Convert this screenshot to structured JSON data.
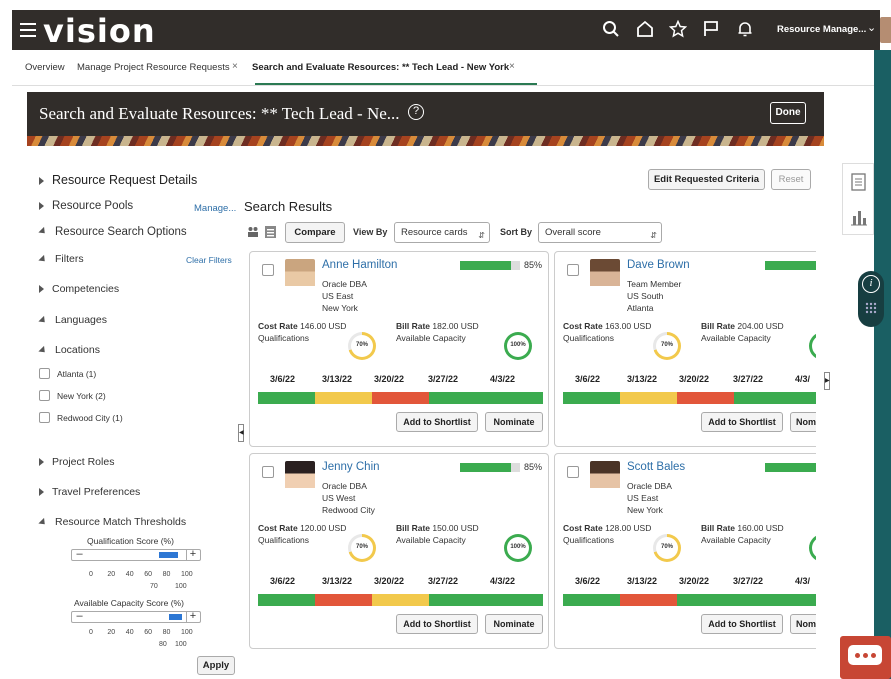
{
  "app": {
    "logo": "vision",
    "user_label": "Resource Manage..."
  },
  "tabs": [
    {
      "label": "Overview",
      "closable": false
    },
    {
      "label": "Manage Project Resource Requests",
      "closable": true
    },
    {
      "label": "Search and Evaluate Resources: ** Tech Lead - New York",
      "closable": true,
      "active": true
    }
  ],
  "hero": {
    "title": "Search and Evaluate Resources: ** Tech Lead - Ne...",
    "done_label": "Done",
    "help": "?"
  },
  "left": {
    "resource_request_details": "Resource Request Details",
    "resource_pools": "Resource Pools",
    "manage_link": "Manage...",
    "resource_search_options": "Resource Search Options",
    "filters": "Filters",
    "clear_filters": "Clear Filters",
    "competencies": "Competencies",
    "languages": "Languages",
    "locations": "Locations",
    "location_options": [
      "Atlanta (1)",
      "New York (2)",
      "Redwood City (1)"
    ],
    "project_roles": "Project Roles",
    "travel_preferences": "Travel Preferences",
    "thresholds": "Resource Match Thresholds",
    "qual_slider": {
      "label": "Qualification Score (%)",
      "ticks": [
        "0",
        "20",
        "40",
        "60",
        "80",
        "100"
      ],
      "value_labels": [
        "70",
        "100"
      ],
      "range": [
        70,
        100
      ]
    },
    "avail_slider": {
      "label": "Available Capacity Score (%)",
      "ticks": [
        "0",
        "20",
        "40",
        "60",
        "80",
        "100"
      ],
      "value_labels": [
        "80",
        "100"
      ],
      "range": [
        80,
        100
      ]
    },
    "apply": "Apply"
  },
  "results": {
    "title": "Search Results",
    "edit_criteria": "Edit Requested Criteria",
    "reset": "Reset",
    "compare": "Compare",
    "view_by_label": "View By",
    "view_by_value": "Resource cards",
    "sort_by_label": "Sort By",
    "sort_by_value": "Overall score",
    "add_to_shortlist": "Add to Shortlist",
    "nominate": "Nominate",
    "nominate_cut": "Nom",
    "cost_rate_label": "Cost Rate",
    "bill_rate_label": "Bill Rate",
    "qualifications_label": "Qualifications",
    "available_capacity_label": "Available Capacity",
    "dates": [
      "3/6/22",
      "3/13/22",
      "3/20/22",
      "3/27/22",
      "4/3/22"
    ],
    "dates_cut": "4/3/",
    "cards": [
      {
        "name": "Anne Hamilton",
        "title": "Oracle DBA",
        "region": "US East",
        "city": "New York",
        "score": "85%",
        "score_value": 85,
        "cost": "146.00 USD",
        "bill": "182.00 USD",
        "qual": "70%",
        "qual_value": 70,
        "cap": "100%",
        "cap_value": 100,
        "avail": [
          "green",
          "yellow",
          "red",
          "green",
          "green"
        ]
      },
      {
        "name": "Dave Brown",
        "title": "Team Member",
        "region": "US South",
        "city": "Atlanta",
        "score": "",
        "score_value": 85,
        "cost": "163.00 USD",
        "bill": "204.00 USD",
        "qual": "70%",
        "qual_value": 70,
        "cap": "",
        "cap_value": 100,
        "avail": [
          "green",
          "yellow",
          "red",
          "green",
          "green"
        ]
      },
      {
        "name": "Jenny Chin",
        "title": "Oracle DBA",
        "region": "US West",
        "city": "Redwood City",
        "score": "85%",
        "score_value": 85,
        "cost": "120.00 USD",
        "bill": "150.00 USD",
        "qual": "70%",
        "qual_value": 70,
        "cap": "100%",
        "cap_value": 100,
        "avail": [
          "green",
          "red",
          "yellow",
          "green",
          "green"
        ]
      },
      {
        "name": "Scott Bales",
        "title": "Oracle DBA",
        "region": "US East",
        "city": "New York",
        "score": "",
        "score_value": 85,
        "cost": "128.00 USD",
        "bill": "160.00 USD",
        "qual": "70%",
        "qual_value": 70,
        "cap": "",
        "cap_value": 100,
        "avail": [
          "green",
          "red",
          "green",
          "green",
          "green"
        ]
      }
    ]
  },
  "colors": {
    "green": "#3bab4f",
    "yellow": "#f2c94c",
    "red": "#e2563a",
    "link": "#2e6fa8",
    "header": "#312d2a",
    "teal": "#1a5f63",
    "chat": "#c74634"
  }
}
